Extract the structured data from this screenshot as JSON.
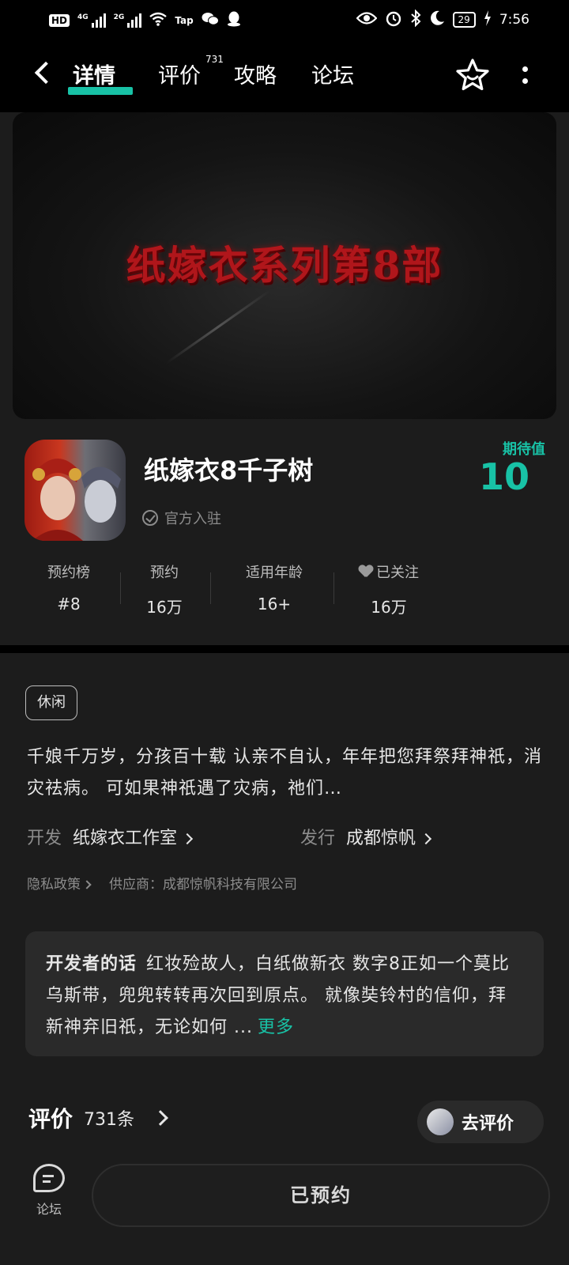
{
  "status_bar": {
    "hd": "HD",
    "net1": "4G",
    "net2": "2G",
    "tap": "Tap",
    "battery": "29",
    "time": "7:56"
  },
  "nav": {
    "tabs": [
      "详情",
      "评价",
      "攻略",
      "论坛"
    ],
    "review_count_badge": "731"
  },
  "banner": {
    "title": "纸嫁衣系列第8部"
  },
  "game": {
    "name": "纸嫁衣8千子树",
    "official_label": "官方入驻",
    "expect_label": "期待值",
    "expect_value": "10"
  },
  "stats": [
    {
      "label": "预约榜",
      "value": "#8"
    },
    {
      "label": "预约",
      "value": "16万"
    },
    {
      "label": "适用年龄",
      "value": "16+"
    },
    {
      "label": "已关注",
      "value": "16万"
    }
  ],
  "description": {
    "tag": "休闲",
    "intro": "千娘千万岁，分孩百十载 认亲不自认，年年把您拜祭拜神祇，消灾祛病。 可如果神祇遇了灾病，祂们…",
    "developer_key": "开发",
    "developer_value": "纸嫁衣工作室",
    "publisher_key": "发行",
    "publisher_value": "成都惊帆",
    "privacy": "隐私政策",
    "supplier": "供应商：成都惊帆科技有限公司"
  },
  "dev_words": {
    "title": "开发者的话",
    "text": "红妆殓故人，白纸做新衣 数字8正如一个莫比乌斯带，兜兜转转再次回到原点。 就像奘铃村的信仰，拜新神弃旧祇，无论如何 ...",
    "more": "更多"
  },
  "reviews": {
    "title": "评价",
    "count": "731条",
    "write_button": "去评价"
  },
  "bottom": {
    "forum_label": "论坛",
    "reserved_button": "已预约"
  },
  "colors": {
    "accent": "#18c2a6",
    "background": "#1c1c1c",
    "banner_title": "#b0161b"
  }
}
